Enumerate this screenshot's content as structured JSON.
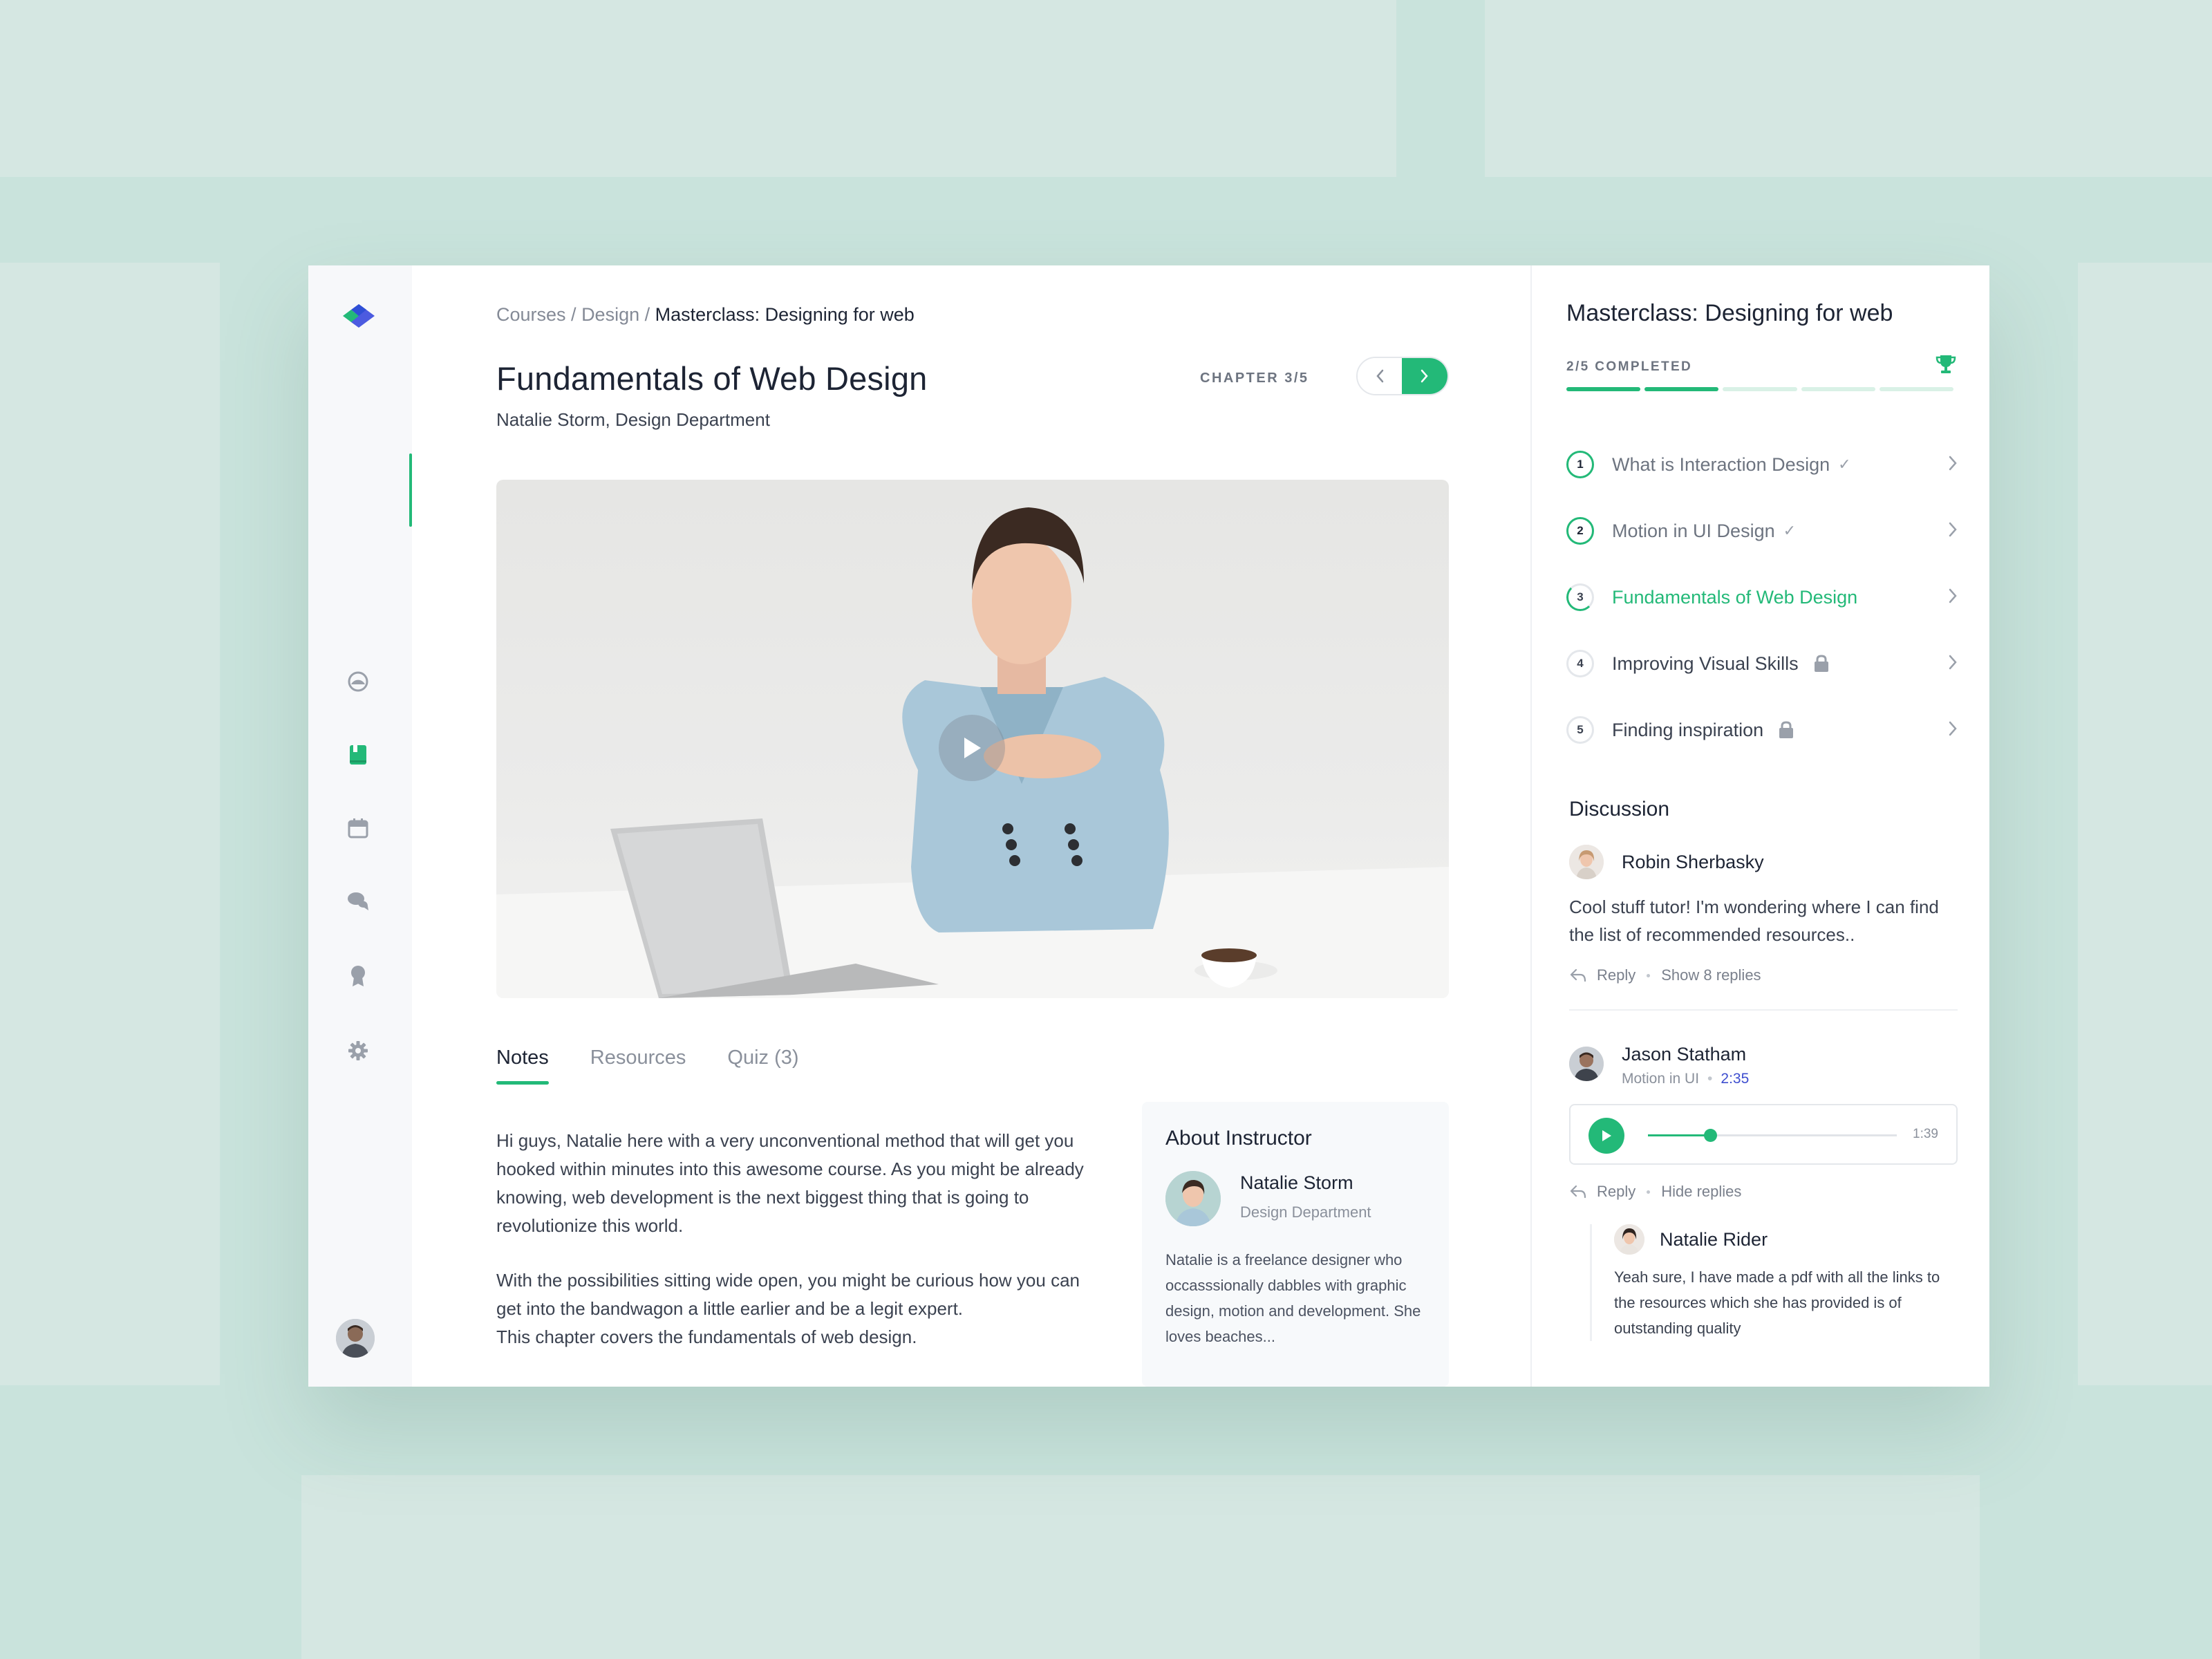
{
  "breadcrumb": {
    "part1": "Courses",
    "sep1": " / ",
    "part2": "Design",
    "sep2": " / ",
    "current": "Masterclass: Designing for web"
  },
  "lesson": {
    "title": "Fundamentals of Web Design",
    "subtitle": "Natalie Storm, Design Department",
    "chapter_label": "CHAPTER 3/5"
  },
  "tabs": [
    {
      "label": "Notes",
      "active": true
    },
    {
      "label": "Resources",
      "active": false
    },
    {
      "label": "Quiz (3)",
      "active": false
    }
  ],
  "notes": {
    "p1": "Hi guys, Natalie here with a very unconventional method that will get you hooked within minutes into this awesome course. As you might be already knowing, web  development is the next biggest thing that is going to revolutionize this world.",
    "p2": "With the possibilities sitting wide open, you might be curious how you can get into the bandwagon a little earlier and be a legit expert.",
    "p3": "This chapter covers the fundamentals of web design."
  },
  "instructor": {
    "heading": "About Instructor",
    "name": "Natalie Storm",
    "department": "Design Department",
    "bio": "Natalie is a freelance designer who occasssionally dabbles with graphic design, motion and development. She loves beaches..."
  },
  "course": {
    "title": "Masterclass: Designing for web",
    "progress_label": "2/5 COMPLETED",
    "completed": 2,
    "total": 5
  },
  "chapters": [
    {
      "num": "1",
      "title": "What is Interaction Design",
      "status": "complete",
      "mark": "✓"
    },
    {
      "num": "2",
      "title": "Motion in UI Design",
      "status": "complete",
      "mark": "✓"
    },
    {
      "num": "3",
      "title": "Fundamentals of Web Design",
      "status": "current",
      "mark": ""
    },
    {
      "num": "4",
      "title": "Improving Visual Skills",
      "status": "locked",
      "mark": ""
    },
    {
      "num": "5",
      "title": "Finding inspiration",
      "status": "locked",
      "mark": ""
    }
  ],
  "discussion": {
    "heading": "Discussion",
    "c1": {
      "name": "Robin Sherbasky",
      "text": "Cool stuff tutor! I'm wondering where I can find the list of recommended resources..",
      "reply": "Reply",
      "toggle": "Show 8 replies"
    },
    "c2": {
      "name": "Jason Statham",
      "context": "Motion in UI",
      "time": "2:35",
      "audio_duration": "1:39",
      "audio_progress": 0.25,
      "reply": "Reply",
      "toggle": "Hide replies"
    },
    "c3": {
      "name": "Natalie Rider",
      "text": "Yeah sure, I have made a pdf with all the links to the resources which she has provided is of outstanding quality"
    }
  },
  "colors": {
    "accent": "#23b978",
    "link": "#3e4ecf",
    "text": "#1d2434"
  },
  "icons": {
    "nav": [
      "dashboard-icon",
      "book-icon",
      "calendar-icon",
      "chat-icon",
      "award-icon",
      "settings-icon"
    ]
  }
}
